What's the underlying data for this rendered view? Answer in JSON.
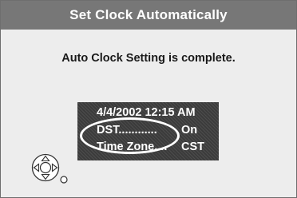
{
  "dialog": {
    "title": "Set Clock Automatically",
    "message": "Auto Clock Setting is complete."
  },
  "info": {
    "datetime": "4/4/2002 12:15 AM",
    "dst_label": "DST............",
    "dst_value": "On",
    "timezone_label": "Time Zone....",
    "timezone_value": "CST"
  },
  "icons": {
    "navigation": "remote-direction-pad-icon",
    "select": "ok-button-icon"
  },
  "colors": {
    "title_bar": "#777777",
    "panel_background": "#ededed",
    "info_box": "#3b3b3b",
    "text_light": "#ffffff",
    "text_dark": "#1a1a1a"
  }
}
